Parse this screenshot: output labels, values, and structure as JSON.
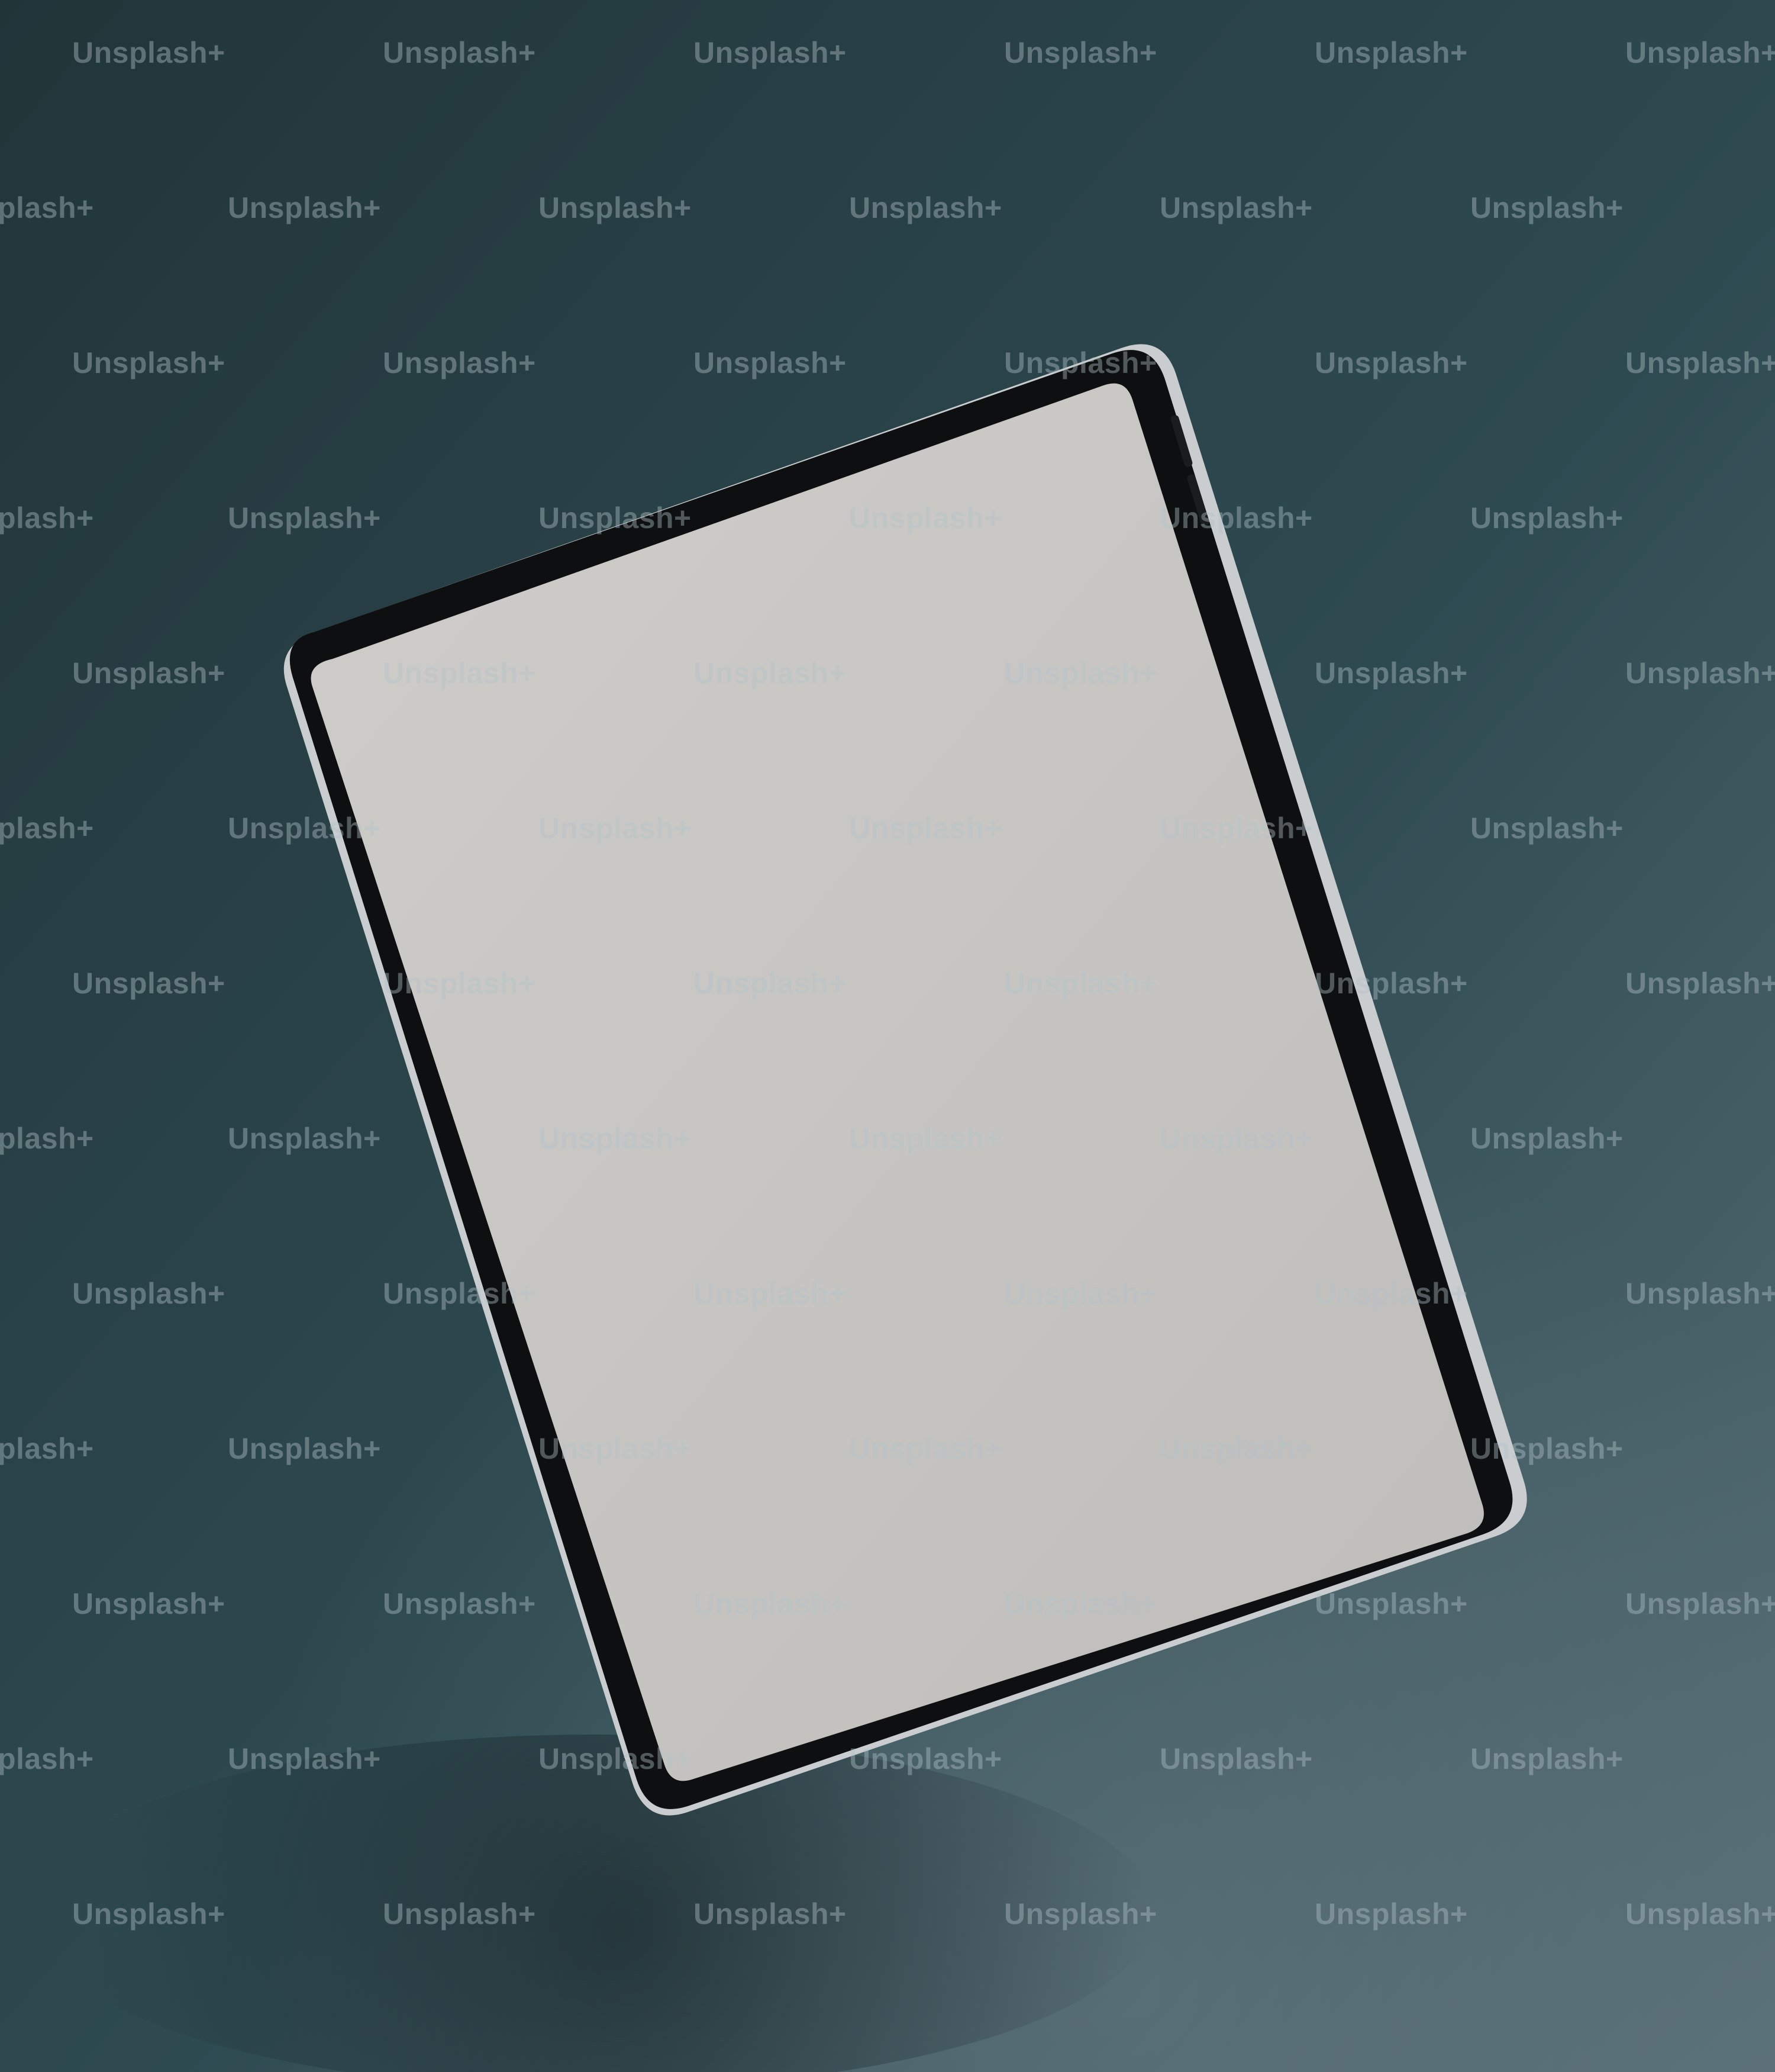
{
  "scene": {
    "subject": "tablet-mockup",
    "screen_state": "blank",
    "watermark_text": "Unsplash+"
  },
  "colors": {
    "background_dark": "#213539",
    "background_light": "#5a7077",
    "bezel": "#0d0f10",
    "frame_edge": "#c9cdcf",
    "screen": "#c4c2bf"
  }
}
